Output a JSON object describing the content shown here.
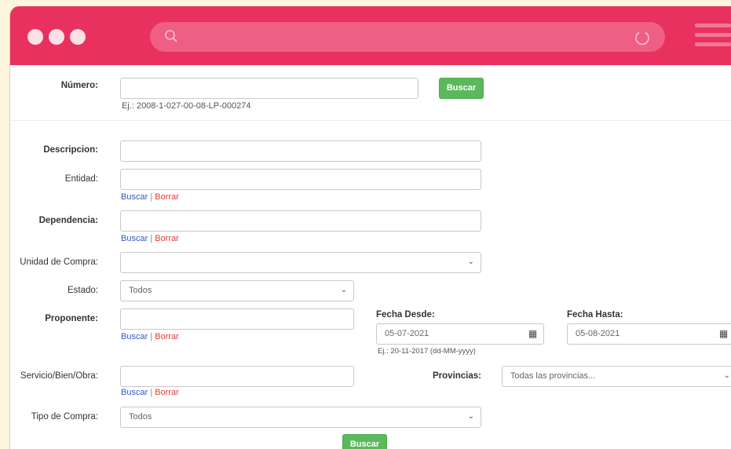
{
  "browser": {
    "window_dots": 3,
    "url": "",
    "icons": {
      "search": "search-icon",
      "reload": "reload-icon",
      "menu": "hamburger-menu-icon"
    }
  },
  "colors": {
    "titlebar": "#e8315f",
    "button": "#5cb85c",
    "link_blue": "#3355cc",
    "link_red": "#e53935"
  },
  "form": {
    "numero": {
      "label": "Número:",
      "value": "",
      "button": "Buscar",
      "hint": "Ej.: 2008-1-027-00-08-LP-000274"
    },
    "descripcion": {
      "label": "Descripcion:",
      "value": ""
    },
    "entidad": {
      "label": "Entidad:",
      "value": "",
      "link_search": "Buscar",
      "link_sep": "|",
      "link_clear": "Borrar"
    },
    "dependencia": {
      "label": "Dependencia:",
      "value": "",
      "link_search": "Buscar",
      "link_sep": "|",
      "link_clear": "Borrar"
    },
    "unidad_compra": {
      "label": "Unidad de Compra:",
      "value": ""
    },
    "estado": {
      "label": "Estado:",
      "value": "Todos"
    },
    "proponente": {
      "label": "Proponente:",
      "value": "",
      "link_search": "Buscar",
      "link_sep": "|",
      "link_clear": "Borrar"
    },
    "fecha_desde": {
      "label": "Fecha Desde:",
      "value": "05-07-2021",
      "hint": "Ej.: 20-11-2017 (dd-MM-yyyy)",
      "icon": "calendar-icon"
    },
    "fecha_hasta": {
      "label": "Fecha Hasta:",
      "value": "05-08-2021",
      "icon": "calendar-icon"
    },
    "servicio": {
      "label": "Servicio/Bien/Obra:",
      "value": "",
      "link_search": "Buscar",
      "link_sep": "|",
      "link_clear": "Borrar"
    },
    "provincias": {
      "label": "Provincias:",
      "value": "Todas las provincias..."
    },
    "tipo_compra": {
      "label": "Tipo de Compra:",
      "value": "Todos"
    },
    "submit": "Buscar"
  }
}
